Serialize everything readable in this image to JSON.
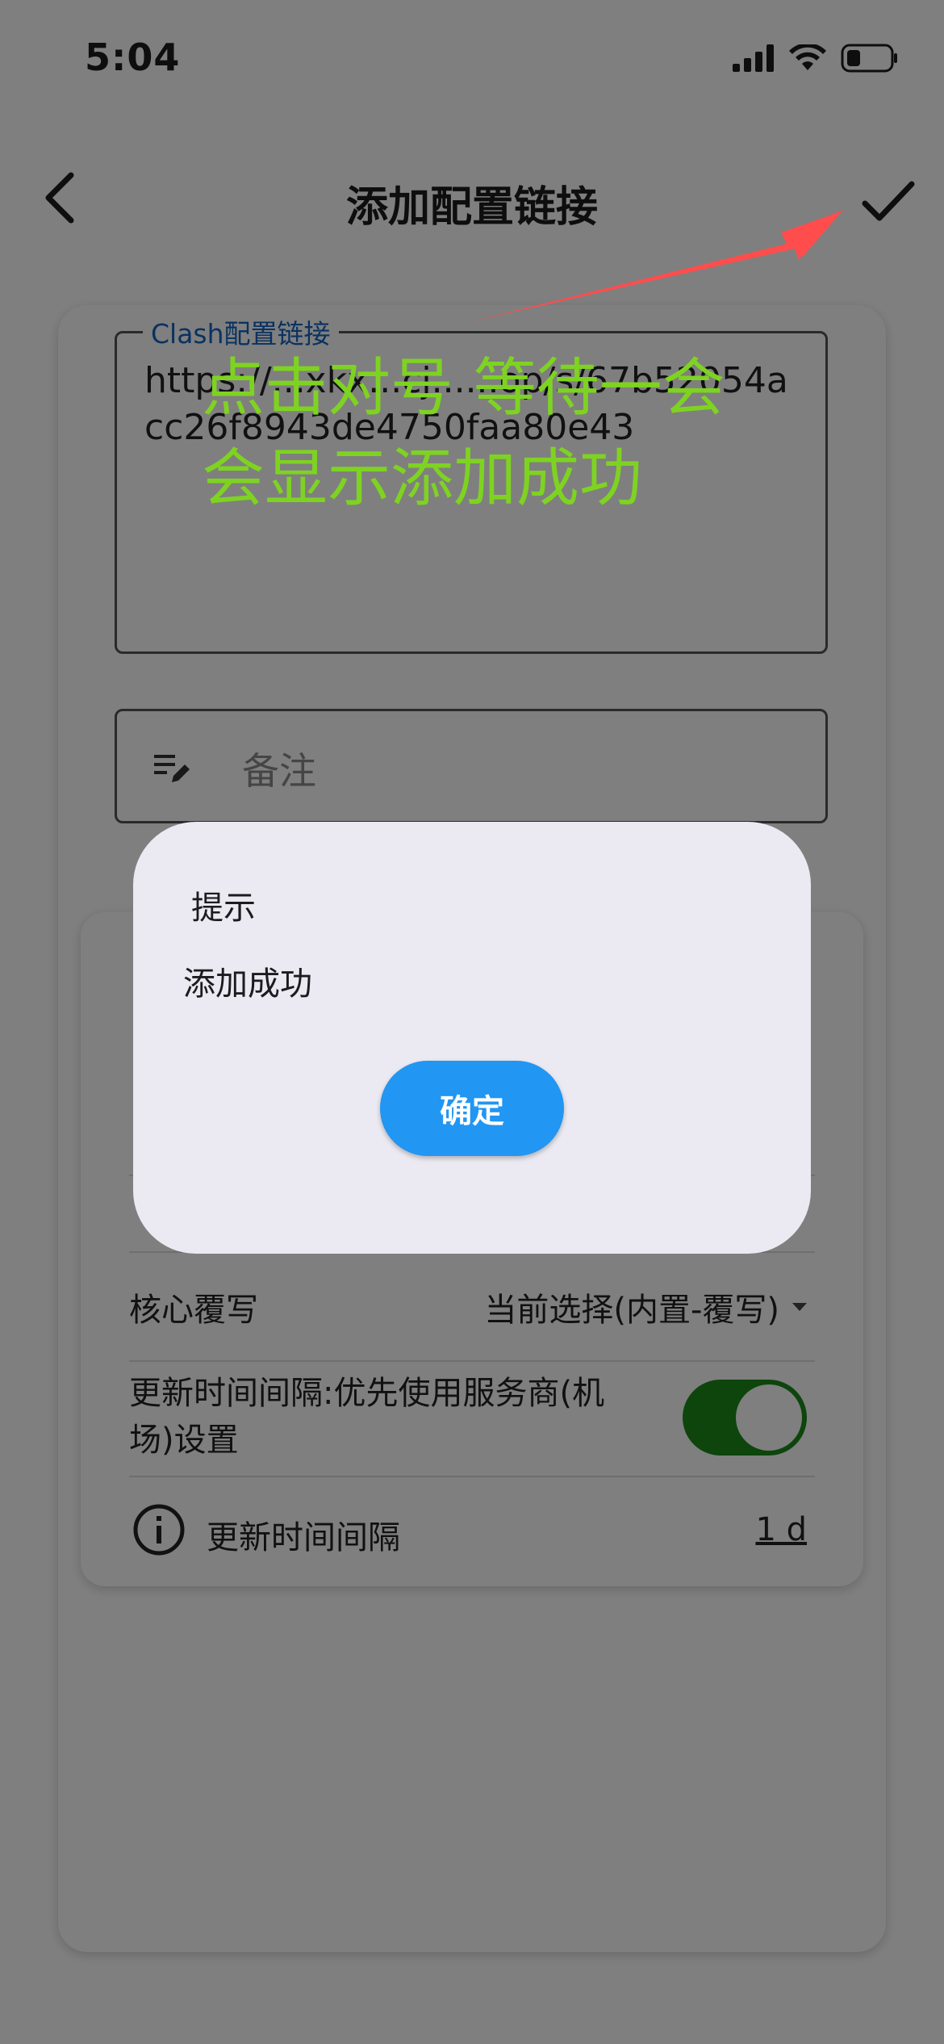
{
  "status_bar": {
    "time": "5:04"
  },
  "app_bar": {
    "title": "添加配置链接"
  },
  "form": {
    "url_label": "Clash配置链接",
    "url_value": "https://...xkx...cj......op/s/67b52054acc26f8943de4750faa80e43",
    "note_placeholder": "备注"
  },
  "settings": {
    "core_override_label": "核心覆写",
    "core_override_value": "当前选择(内置-覆写)",
    "update_interval_provider_label": "更新时间间隔:优先使用服务商(机场)设置",
    "update_interval_provider_enabled": true,
    "update_interval_label": "更新时间间隔",
    "update_interval_value": "1 d"
  },
  "annotation": {
    "line1": "点击对号 等待一会",
    "line2": "会显示添加成功",
    "color": "#7ed321",
    "arrow_color": "#ff4d4d"
  },
  "dialog": {
    "title": "提示",
    "message": "添加成功",
    "ok_label": "确定",
    "ok_color": "#2196f3"
  }
}
